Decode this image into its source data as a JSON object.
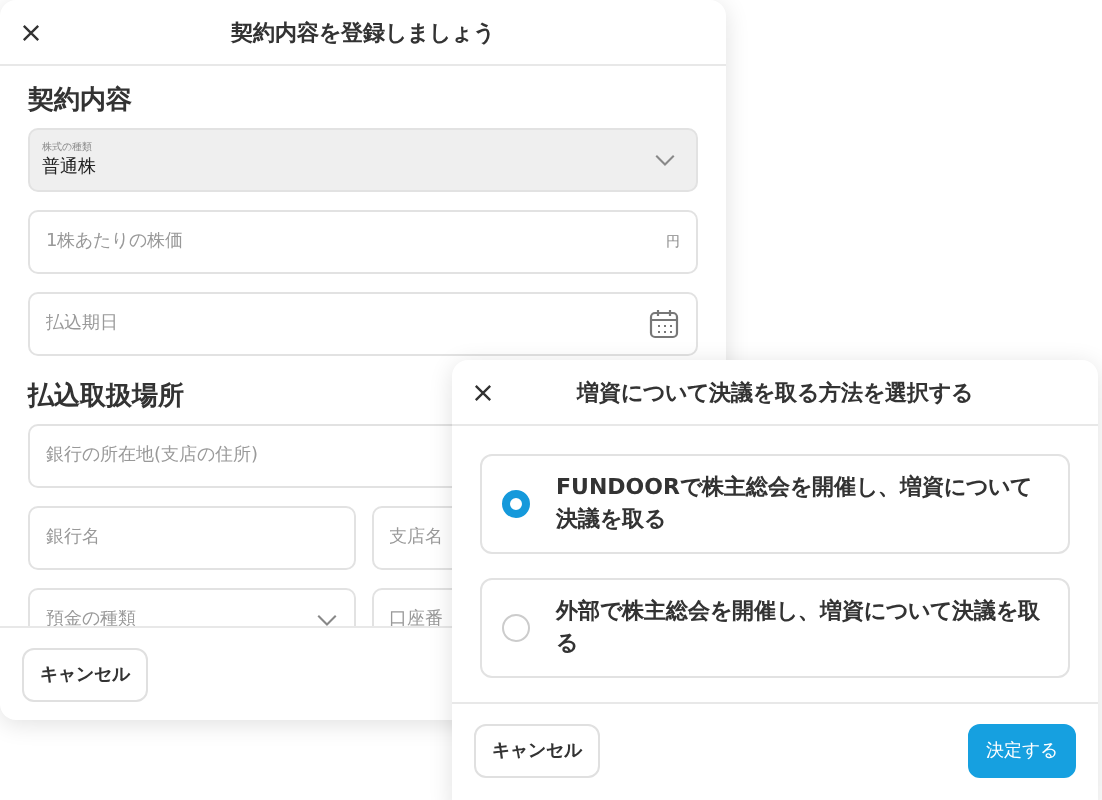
{
  "back_dialog": {
    "title": "契約内容を登録しましょう",
    "section_1": {
      "heading": "契約内容",
      "share_type": {
        "label": "株式の種類",
        "value": "普通株"
      },
      "price": {
        "placeholder": "1株あたりの株価",
        "unit": "円"
      },
      "due_date": {
        "placeholder": "払込期日"
      }
    },
    "section_2": {
      "heading": "払込取扱場所",
      "bank_address": {
        "placeholder": "銀行の所在地(支店の住所)"
      },
      "bank_name": {
        "placeholder": "銀行名"
      },
      "branch_name": {
        "placeholder": "支店名"
      },
      "deposit_type": {
        "placeholder": "預金の種類"
      },
      "account_number": {
        "placeholder": "口座番"
      }
    },
    "cancel": "キャンセル"
  },
  "front_dialog": {
    "title": "増資について決議を取る方法を選択する",
    "options": [
      {
        "label": "**FUNDOOR**で株主総会を開催し、増資について決議を取る",
        "selected": true
      },
      {
        "label": "外部で株主総会を開催し、増資について決議を取る",
        "selected": false
      }
    ],
    "cancel": "キャンセル",
    "confirm": "決定する"
  }
}
